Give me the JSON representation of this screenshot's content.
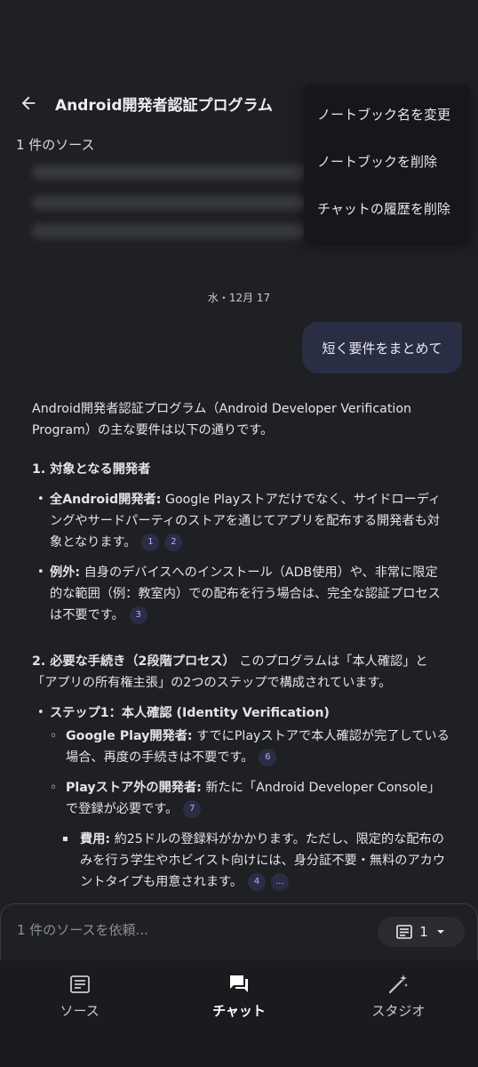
{
  "header": {
    "title": "Android開発者認証プログラム",
    "source_count": "1 件のソース"
  },
  "menu": {
    "items": [
      "ノートブック名を変更",
      "ノートブックを削除",
      "チャットの履歴を削除"
    ]
  },
  "chat": {
    "date": "水・12月 17",
    "user_message": "短く要件をまとめて",
    "intro": "Android開発者認証プログラム（Android Developer Verification Program）の主な要件は以下の通りです。",
    "section1_title": "1. 対象となる開発者",
    "s1_b1_label": "全Android開発者:",
    "s1_b1_text": " Google Playストアだけでなく、サイドローディングやサードパーティのストアを通じてアプリを配布する開発者も対象となります。",
    "s1_b1_cites": [
      "1",
      "2"
    ],
    "s1_b2_label": "例外:",
    "s1_b2_text": " 自身のデバイスへのインストール（ADB使用）や、非常に限定的な範囲（例：教室内）での配布を行う場合は、完全な認証プロセスは不要です。",
    "s1_b2_cites": [
      "3"
    ],
    "section2_title": "2. 必要な手続き（2段階プロセス）",
    "section2_text": " このプログラムは「本人確認」と「アプリの所有権主張」の2つのステップで構成されています。",
    "step1_label": "ステップ1：本人確認 (Identity Verification)",
    "gp_label": "Google Play開発者:",
    "gp_text": " すでにPlayストアで本人確認が完了している場合、再度の手続きは不要です。",
    "gp_cites": [
      "6"
    ],
    "ext_label": "Playストア外の開発者:",
    "ext_text": " 新たに「Android Developer Console」で登録が必要です。",
    "ext_cites": [
      "7"
    ],
    "fee_label": "費用:",
    "fee_text": " 約25ドルの登録料がかかります。ただし、限定的な配布のみを行う学生やホビイスト向けには、身分証不要・無料のアカウントタイプも用意されます。",
    "fee_cites": [
      "4",
      "..."
    ]
  },
  "input": {
    "placeholder": "1 件のソースを依頼...",
    "source_selector": "1"
  },
  "nav": {
    "items": [
      {
        "label": "ソース",
        "icon": "source-icon"
      },
      {
        "label": "チャット",
        "icon": "chat-icon"
      },
      {
        "label": "スタジオ",
        "icon": "studio-icon"
      }
    ]
  }
}
